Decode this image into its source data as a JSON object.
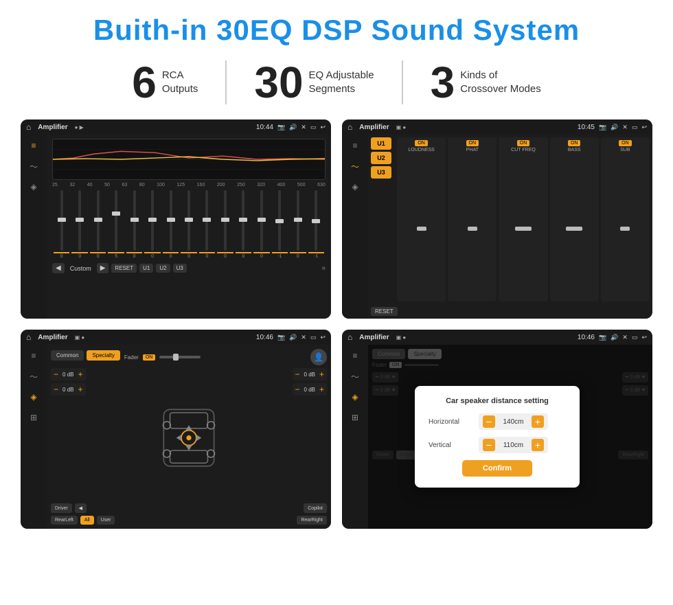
{
  "title": "Buith-in 30EQ DSP Sound System",
  "stats": [
    {
      "number": "6",
      "label": "RCA\nOutputs"
    },
    {
      "number": "30",
      "label": "EQ Adjustable\nSegments"
    },
    {
      "number": "3",
      "label": "Kinds of\nCrossover Modes"
    }
  ],
  "screen1": {
    "status": {
      "title": "Amplifier",
      "time": "10:44",
      "icons": "📍 🔊 ✕ ⬜ ↩"
    },
    "eq_freqs": [
      "25",
      "32",
      "40",
      "50",
      "63",
      "80",
      "100",
      "125",
      "160",
      "200",
      "250",
      "320",
      "400",
      "500",
      "630"
    ],
    "eq_vals": [
      "0",
      "0",
      "0",
      "5",
      "0",
      "0",
      "0",
      "0",
      "0",
      "0",
      "0",
      "0",
      "-1",
      "0",
      "-1"
    ],
    "eq_preset": "Custom",
    "buttons": [
      "RESET",
      "U1",
      "U2",
      "U3"
    ]
  },
  "screen2": {
    "status": {
      "title": "Amplifier",
      "time": "10:45"
    },
    "u_buttons": [
      "U1",
      "U2",
      "U3"
    ],
    "channels": [
      "LOUDNESS",
      "PHAT",
      "CUT FREQ",
      "BASS",
      "SUB"
    ],
    "channel_on": [
      true,
      true,
      true,
      true,
      true
    ],
    "reset_label": "RESET"
  },
  "screen3": {
    "status": {
      "title": "Amplifier",
      "time": "10:46"
    },
    "tabs": [
      "Common",
      "Specialty"
    ],
    "fader_label": "Fader",
    "fader_on": "ON",
    "db_values": [
      "0 dB",
      "0 dB",
      "0 dB",
      "0 dB"
    ],
    "bottom_btns": [
      "Driver",
      "",
      "Copilot",
      "RearLeft",
      "All",
      "",
      "User",
      "RearRight"
    ]
  },
  "screen4": {
    "status": {
      "title": "Amplifier",
      "time": "10:46"
    },
    "dialog": {
      "title": "Car speaker distance setting",
      "rows": [
        {
          "label": "Horizontal",
          "value": "140cm"
        },
        {
          "label": "Vertical",
          "value": "110cm"
        }
      ],
      "confirm": "Confirm"
    }
  }
}
